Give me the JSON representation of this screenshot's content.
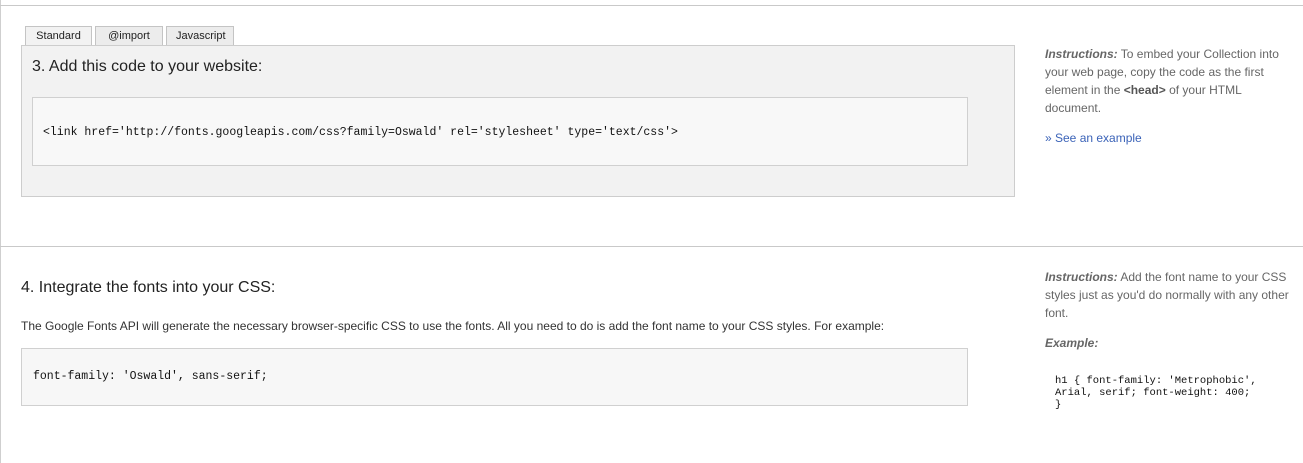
{
  "tabs": [
    {
      "label": "Standard",
      "active": true
    },
    {
      "label": "@import",
      "active": false
    },
    {
      "label": "Javascript",
      "active": false
    }
  ],
  "section3": {
    "title": "3. Add this code to your website:",
    "code": "<link href='http://fonts.googleapis.com/css?family=Oswald' rel='stylesheet' type='text/css'>"
  },
  "instructions1": {
    "label": "Instructions:",
    "text_before": " To embed your Collection into your web page, copy the code as the first element in the ",
    "bold": "<head>",
    "text_after": " of your HTML document.",
    "link": "» See an example"
  },
  "section4": {
    "title": "4. Integrate the fonts into your CSS:",
    "description": "The Google Fonts API will generate the necessary browser-specific CSS to use the fonts. All you need to do is add the font name to your CSS styles. For example:",
    "code": "font-family: 'Oswald', sans-serif;"
  },
  "instructions2": {
    "label": "Instructions:",
    "text": " Add the font name to your CSS styles just as you'd do normally with any other font.",
    "example_label": "Example:",
    "example_code": "h1 { font-family: 'Metrophobic',\nArial, serif; font-weight: 400;\n}"
  }
}
